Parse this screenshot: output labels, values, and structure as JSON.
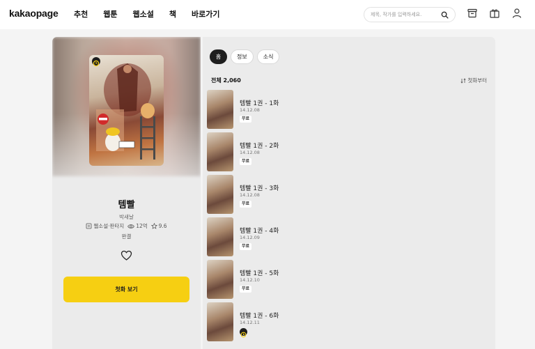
{
  "brand": {
    "logo": "kakaopage",
    "accent": "#f6cf12"
  },
  "nav": {
    "items": [
      "추천",
      "웹툰",
      "웹소설",
      "책",
      "바로가기"
    ]
  },
  "search": {
    "placeholder": "제목, 작가를 입력하세요."
  },
  "header_icons": [
    "archive-icon",
    "gift-icon",
    "user-icon"
  ],
  "work": {
    "title": "템빨",
    "author": "박새날",
    "genre": "웹소설·판타지",
    "views": "12억",
    "rating": "9.6",
    "status": "완결",
    "cta_label": "첫화 보기"
  },
  "tabs": [
    {
      "label": "홈",
      "active": true
    },
    {
      "label": "정보",
      "active": false
    },
    {
      "label": "소식",
      "active": false
    }
  ],
  "list_header": {
    "total": "전체 2,060",
    "sort": "첫화부터"
  },
  "episodes": [
    {
      "title": "템빨 1권 - 1화",
      "date": "14.12.08",
      "badge": "무료"
    },
    {
      "title": "템빨 1권 - 2화",
      "date": "14.12.08",
      "badge": "무료"
    },
    {
      "title": "템빨 1권 - 3화",
      "date": "14.12.08",
      "badge": "무료"
    },
    {
      "title": "템빨 1권 - 4화",
      "date": "14.12.09",
      "badge": "무료"
    },
    {
      "title": "템빨 1권 - 5화",
      "date": "14.12.10",
      "badge": "무료"
    },
    {
      "title": "템빨 1권 - 6화",
      "date": "14.12.11",
      "badge": "wait-free-icon"
    }
  ]
}
